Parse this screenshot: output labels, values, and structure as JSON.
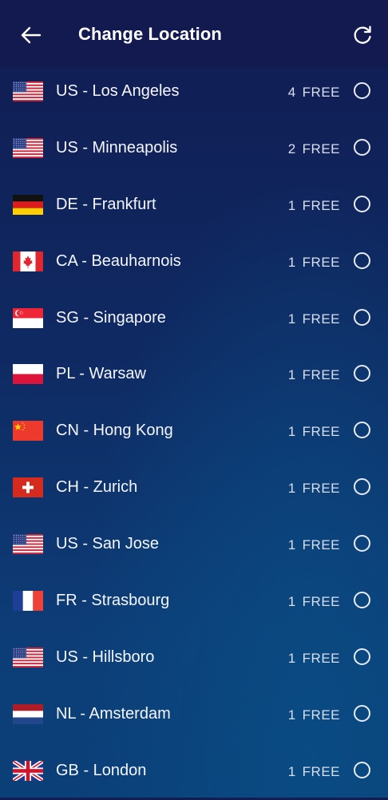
{
  "header": {
    "title": "Change Location"
  },
  "locations": [
    {
      "flag": "us",
      "name": "US - Los Angeles",
      "count": "4",
      "free": "FREE"
    },
    {
      "flag": "us",
      "name": "US - Minneapolis",
      "count": "2",
      "free": "FREE"
    },
    {
      "flag": "de",
      "name": "DE - Frankfurt",
      "count": "1",
      "free": "FREE"
    },
    {
      "flag": "ca",
      "name": "CA - Beauharnois",
      "count": "1",
      "free": "FREE"
    },
    {
      "flag": "sg",
      "name": "SG - Singapore",
      "count": "1",
      "free": "FREE"
    },
    {
      "flag": "pl",
      "name": "PL - Warsaw",
      "count": "1",
      "free": "FREE"
    },
    {
      "flag": "cn",
      "name": "CN - Hong Kong",
      "count": "1",
      "free": "FREE"
    },
    {
      "flag": "ch",
      "name": "CH - Zurich",
      "count": "1",
      "free": "FREE"
    },
    {
      "flag": "us",
      "name": "US - San Jose",
      "count": "1",
      "free": "FREE"
    },
    {
      "flag": "fr",
      "name": "FR - Strasbourg",
      "count": "1",
      "free": "FREE"
    },
    {
      "flag": "us",
      "name": "US - Hillsboro",
      "count": "1",
      "free": "FREE"
    },
    {
      "flag": "nl",
      "name": "NL - Amsterdam",
      "count": "1",
      "free": "FREE"
    },
    {
      "flag": "gb",
      "name": "GB - London",
      "count": "1",
      "free": "FREE"
    }
  ]
}
